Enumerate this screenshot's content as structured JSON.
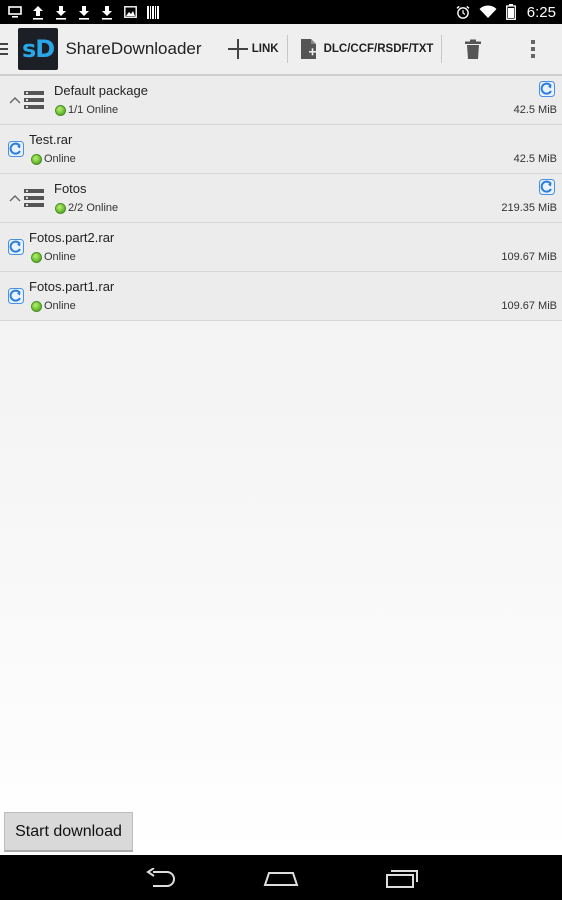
{
  "status_bar": {
    "time": "6:25",
    "left_icons": [
      "screen-icon",
      "upload-icon",
      "download-icon",
      "download-icon",
      "download-icon",
      "image-icon",
      "barcode-icon"
    ],
    "right_icons": [
      "alarm-icon",
      "wifi-icon",
      "battery-icon"
    ]
  },
  "action_bar": {
    "app_title": "ShareDownloader",
    "logo_text": "sD",
    "link_label": "LINK",
    "file_label": "DLC/CCF/RSDF/TXT"
  },
  "list": {
    "rows": [
      {
        "type": "package",
        "name": "Default package",
        "status": "1/1 Online",
        "size": "42.5 MiB"
      },
      {
        "type": "file",
        "name": "Test.rar",
        "status": "Online",
        "size": "42.5 MiB"
      },
      {
        "type": "package",
        "name": "Fotos",
        "status": "2/2 Online",
        "size": "219.35 MiB"
      },
      {
        "type": "file",
        "name": "Fotos.part2.rar",
        "status": "Online",
        "size": "109.67 MiB"
      },
      {
        "type": "file",
        "name": "Fotos.part1.rar",
        "status": "Online",
        "size": "109.67 MiB"
      }
    ]
  },
  "footer": {
    "start_label": "Start download"
  },
  "colors": {
    "accent": "#29a6e8",
    "online": "#6fc13a",
    "actionbar_bg": "#efefef"
  }
}
